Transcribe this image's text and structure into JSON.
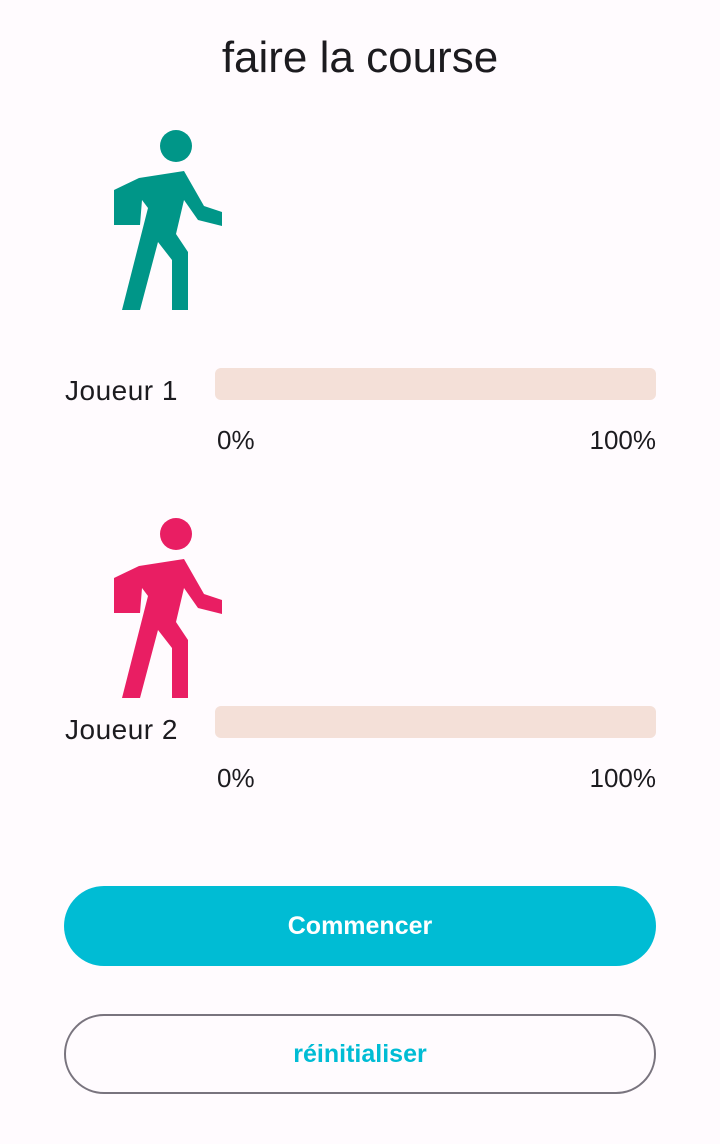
{
  "title": "faire la course",
  "players": [
    {
      "label": "Joueur 1",
      "icon": "walking-person-icon",
      "color": "#009688",
      "progress": 0,
      "min_label": "0%",
      "max_label": "100%"
    },
    {
      "label": "Joueur 2",
      "icon": "walking-person-icon",
      "color": "#e91e63",
      "progress": 0,
      "min_label": "0%",
      "max_label": "100%"
    }
  ],
  "track_color": "#f4e0d8",
  "buttons": {
    "start_label": "Commencer",
    "reset_label": "réinitialiser"
  },
  "colors": {
    "accent": "#00bcd4",
    "background": "#fffbfe"
  }
}
